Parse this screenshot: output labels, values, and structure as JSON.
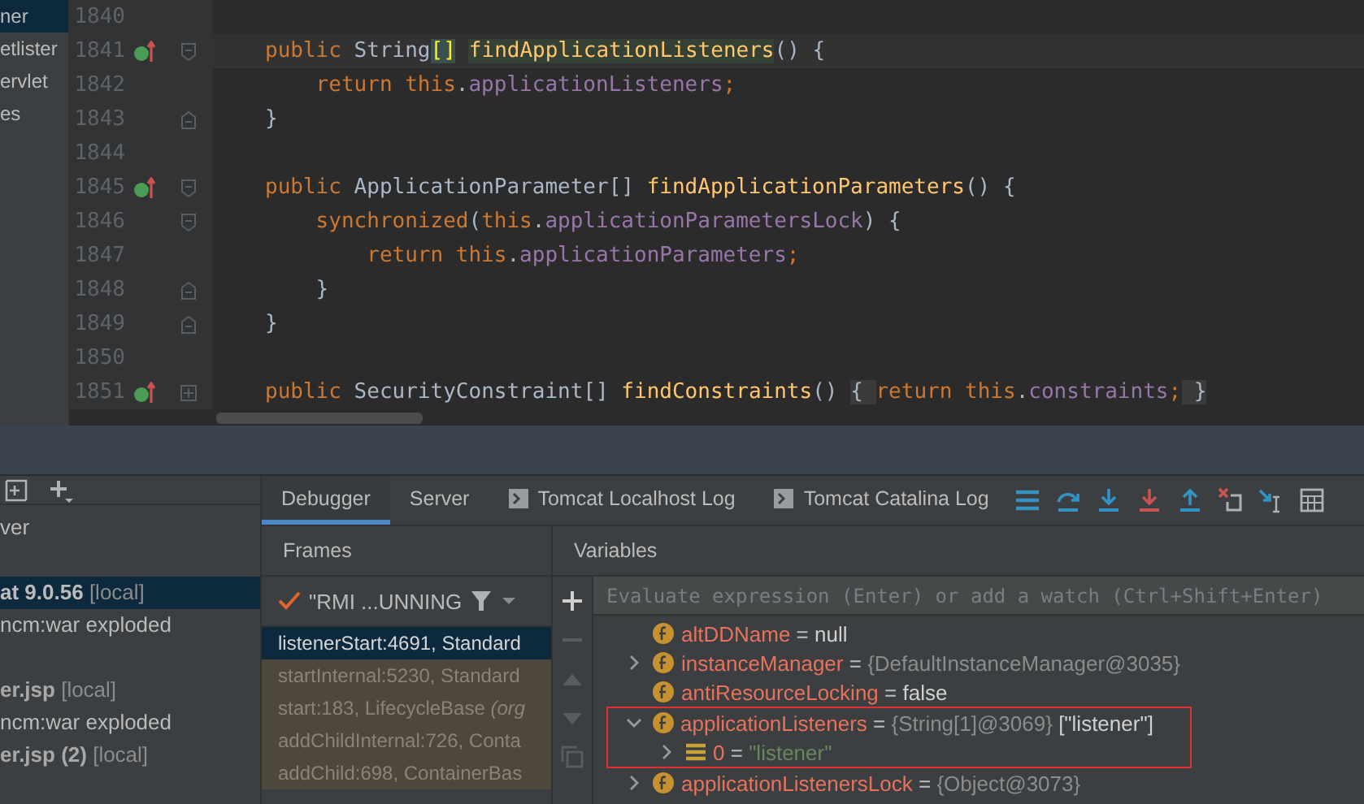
{
  "project_tree": {
    "items": [
      {
        "label": "ner",
        "selected": true
      },
      {
        "label": "etlister",
        "selected": false
      },
      {
        "label": "ervlet",
        "selected": false
      },
      {
        "label": "es",
        "selected": false
      }
    ]
  },
  "editor": {
    "lines": [
      {
        "number": "1840",
        "kind": "plain"
      },
      {
        "number": "1841",
        "marker": true,
        "kind": "opener",
        "current": true,
        "tokens": [
          {
            "kind": "kw",
            "text": "public "
          },
          {
            "kind": "type",
            "text": "String"
          },
          {
            "kind": "bracket-match",
            "text": "[]"
          },
          {
            "kind": "usage-method",
            "text": "findApplicationListeners"
          },
          {
            "kind": "plain",
            "text": "() {"
          }
        ]
      },
      {
        "number": "1842",
        "kind": "plain",
        "tokens": [
          {
            "kind": "kw",
            "text": "    return this"
          },
          {
            "kind": "plain",
            "text": "."
          },
          {
            "kind": "field",
            "text": "applicationListeners"
          },
          {
            "kind": "kw",
            "text": ";"
          }
        ]
      },
      {
        "number": "1843",
        "kind": "closer",
        "tokens": [
          {
            "kind": "plain",
            "text": "}"
          }
        ]
      },
      {
        "number": "1844",
        "kind": "plain"
      },
      {
        "number": "1845",
        "marker": true,
        "kind": "opener",
        "tokens": [
          {
            "kind": "kw",
            "text": "public "
          },
          {
            "kind": "type",
            "text": "ApplicationParameter[] "
          },
          {
            "kind": "method",
            "text": "findApplicationParameters"
          },
          {
            "kind": "plain",
            "text": "() {"
          }
        ]
      },
      {
        "number": "1846",
        "kind": "opener",
        "tokens": [
          {
            "kind": "kw",
            "text": "    synchronized"
          },
          {
            "kind": "plain",
            "text": "("
          },
          {
            "kind": "kw",
            "text": "this"
          },
          {
            "kind": "plain",
            "text": "."
          },
          {
            "kind": "field",
            "text": "applicationParametersLock"
          },
          {
            "kind": "plain",
            "text": ") {"
          }
        ]
      },
      {
        "number": "1847",
        "kind": "plain",
        "tokens": [
          {
            "kind": "kw",
            "text": "        return this"
          },
          {
            "kind": "plain",
            "text": "."
          },
          {
            "kind": "field",
            "text": "applicationParameters"
          },
          {
            "kind": "kw",
            "text": ";"
          }
        ]
      },
      {
        "number": "1848",
        "kind": "closer",
        "tokens": [
          {
            "kind": "plain",
            "text": "    }"
          }
        ]
      },
      {
        "number": "1849",
        "kind": "closer",
        "tokens": [
          {
            "kind": "plain",
            "text": "}"
          }
        ]
      },
      {
        "number": "1850",
        "kind": "plain"
      },
      {
        "number": "1851",
        "marker": true,
        "kind": "collapsed",
        "tokens": [
          {
            "kind": "kw",
            "text": "public "
          },
          {
            "kind": "type",
            "text": "SecurityConstraint[] "
          },
          {
            "kind": "method",
            "text": "findConstraints"
          },
          {
            "kind": "plain",
            "text": "() "
          },
          {
            "kind": "fold-brace",
            "text": "{ "
          },
          {
            "kind": "kw",
            "text": "return this"
          },
          {
            "kind": "plain",
            "text": "."
          },
          {
            "kind": "field",
            "text": "constraints"
          },
          {
            "kind": "kw",
            "text": ";"
          },
          {
            "kind": "fold-brace",
            "text": " }"
          }
        ]
      }
    ]
  },
  "services": {
    "groups": [
      [
        {
          "name": "ver",
          "bold": false,
          "selected": false
        }
      ],
      [
        {
          "name": "at 9.0.56",
          "suffix": "[local]",
          "bold": true,
          "selected": true
        },
        {
          "name": "ncm:war exploded",
          "bold": false,
          "selected": false
        }
      ],
      [
        {
          "name": "er.jsp",
          "suffix": "[local]",
          "bold": true,
          "selected": false
        },
        {
          "name": "ncm:war exploded",
          "bold": false,
          "selected": false
        },
        {
          "name": "er.jsp (2)",
          "suffix": "[local]",
          "bold": true,
          "selected": false
        }
      ]
    ]
  },
  "debugger": {
    "tabs": [
      {
        "label": "Debugger",
        "kind": "plain",
        "selected": true
      },
      {
        "label": "Server",
        "kind": "plain",
        "selected": false
      },
      {
        "label": "Tomcat Localhost Log",
        "kind": "log",
        "selected": false
      },
      {
        "label": "Tomcat Catalina Log",
        "kind": "log",
        "selected": false
      }
    ],
    "frames": {
      "title": "Frames",
      "thread": "\"RMI ...UNNING",
      "items": [
        {
          "label": "listenerStart:4691, Standard",
          "selected": true
        },
        {
          "label": "startInternal:5230, Standard",
          "selected": false
        },
        {
          "label": "start:183, LifecycleBase *(org*",
          "selected": false
        },
        {
          "label": "addChildInternal:726, Conta",
          "selected": false
        },
        {
          "label": "addChild:698, ContainerBas",
          "selected": false
        }
      ]
    },
    "variables": {
      "title": "Variables",
      "placeholder": "Evaluate expression (Enter) or add a watch (Ctrl+Shift+Enter)",
      "items": [
        {
          "kind": "field",
          "name": "altDDName",
          "separator": "=",
          "value": [
            {
              "kind": "plain",
              "text": "null"
            }
          ]
        },
        {
          "kind": "field",
          "name": "instanceManager",
          "separator": "=",
          "expanded": false,
          "value": [
            {
              "kind": "object",
              "text": "{DefaultInstanceManager@3035}"
            }
          ]
        },
        {
          "kind": "field",
          "name": "antiResourceLocking",
          "separator": "=",
          "value": [
            {
              "kind": "plain",
              "text": "false"
            }
          ]
        },
        {
          "kind": "field",
          "name": "applicationListeners",
          "separator": "=",
          "expanded": true,
          "outlined": true,
          "value": [
            {
              "kind": "object",
              "text": "{String[1]@3069}"
            },
            {
              "kind": "plain",
              "text": "[\"listener\"]"
            }
          ],
          "children": [
            {
              "kind": "array",
              "name": "0",
              "separator": "=",
              "expanded": false,
              "value": [
                {
                  "kind": "string",
                  "text": "\"listener\""
                }
              ]
            }
          ]
        },
        {
          "kind": "field",
          "name": "applicationListenersLock",
          "separator": "=",
          "expanded": false,
          "value": [
            {
              "kind": "object",
              "text": "{Object@3073}"
            }
          ]
        }
      ]
    }
  }
}
